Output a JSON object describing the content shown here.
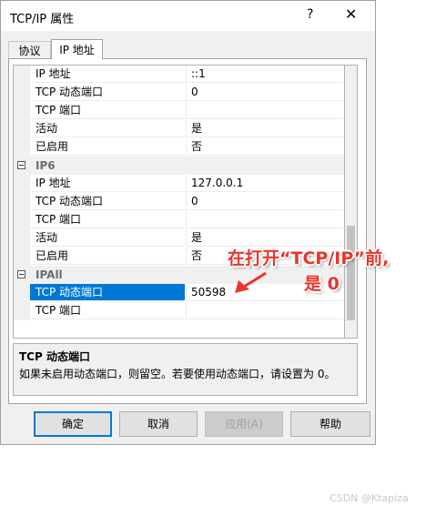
{
  "window": {
    "title": "TCP/IP 属性",
    "help_glyph": "?",
    "close_glyph": "✕"
  },
  "tabs": [
    {
      "label": "协议"
    },
    {
      "label": "IP 地址"
    }
  ],
  "grid": {
    "rows": [
      {
        "name": "IP 地址",
        "value": "::1"
      },
      {
        "name": "TCP 动态端口",
        "value": "0"
      },
      {
        "name": "TCP 端口",
        "value": ""
      },
      {
        "name": "活动",
        "value": "是"
      },
      {
        "name": "已启用",
        "value": "否"
      },
      {
        "category": "IP6"
      },
      {
        "name": "IP 地址",
        "value": "127.0.0.1"
      },
      {
        "name": "TCP 动态端口",
        "value": "0"
      },
      {
        "name": "TCP 端口",
        "value": ""
      },
      {
        "name": "活动",
        "value": "是"
      },
      {
        "name": "已启用",
        "value": "否"
      },
      {
        "category": "IPAll"
      },
      {
        "name": "TCP 动态端口",
        "value": "50598",
        "selected": true
      },
      {
        "name": "TCP 端口",
        "value": ""
      }
    ]
  },
  "description": {
    "title": "TCP 动态端口",
    "text": "如果未启用动态端口，则留空。若要使用动态端口，请设置为 0。"
  },
  "buttons": {
    "ok": "确定",
    "cancel": "取消",
    "apply": "应用(A)",
    "help": "帮助"
  },
  "annotation": {
    "line1": "在打开“TCP/IP”前,",
    "line2": "是 0"
  },
  "watermark": "CSDN @Ktapiza",
  "colors": {
    "selection": "#0078d7",
    "annotation": "#e8372d",
    "category_text": "#6d6d6d"
  }
}
